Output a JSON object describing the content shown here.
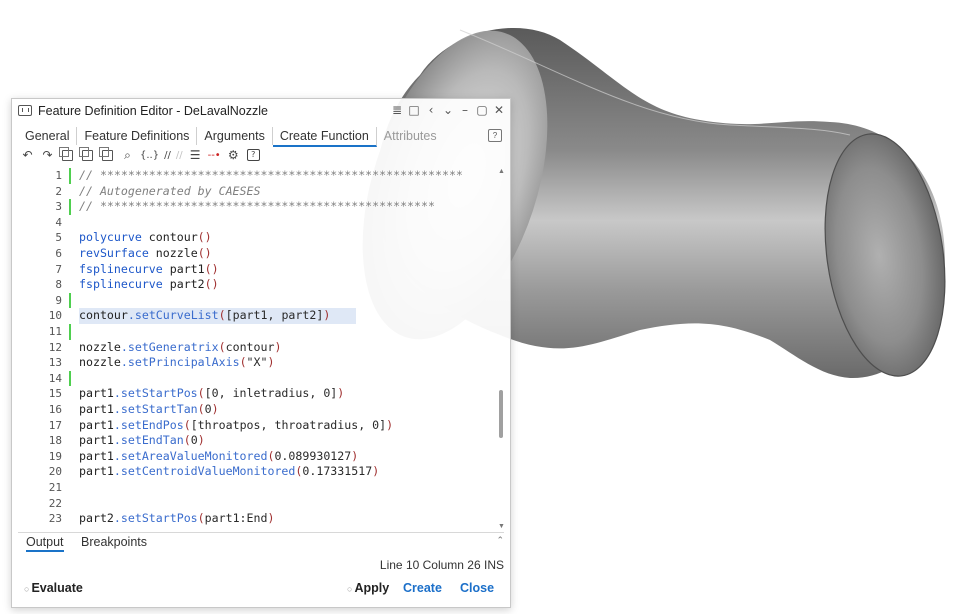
{
  "window": {
    "title": "Feature Definition Editor - DeLavalNozzle",
    "controls": [
      "≣",
      "□",
      "‹",
      "⌄",
      "–",
      "▢",
      "✕"
    ]
  },
  "tabs": [
    {
      "label": "General",
      "active": false,
      "enabled": true
    },
    {
      "label": "Feature Definitions",
      "active": false,
      "enabled": true
    },
    {
      "label": "Arguments",
      "active": false,
      "enabled": true
    },
    {
      "label": "Create Function",
      "active": true,
      "enabled": true
    },
    {
      "label": "Attributes",
      "active": false,
      "enabled": false
    }
  ],
  "toolbar": {
    "undo": "↶",
    "redo": "↷",
    "search": "⌕",
    "braces": "{..}",
    "comment": "//",
    "uncomment": "//",
    "indent": "☰",
    "breakpoint": "--•",
    "settings": "⚙",
    "help": "?"
  },
  "editor": {
    "lines": [
      {
        "n": "1",
        "kind": "comment",
        "text": "// ****************************************************",
        "changed": true
      },
      {
        "n": "2",
        "kind": "comment",
        "text": "// Autogenerated by CAESES",
        "changed": false
      },
      {
        "n": "3",
        "kind": "comment",
        "text": "// ************************************************",
        "changed": true
      },
      {
        "n": "4",
        "kind": "blank",
        "text": "",
        "changed": false
      },
      {
        "n": "5",
        "kind": "decl",
        "type": "polycurve",
        "name": "contour",
        "changed": false
      },
      {
        "n": "6",
        "kind": "decl",
        "type": "revSurface",
        "name": "nozzle",
        "changed": false
      },
      {
        "n": "7",
        "kind": "decl",
        "type": "fsplinecurve",
        "name": "part1",
        "changed": false
      },
      {
        "n": "8",
        "kind": "decl",
        "type": "fsplinecurve",
        "name": "part2",
        "changed": false
      },
      {
        "n": "9",
        "kind": "blank",
        "text": "",
        "changed": true
      },
      {
        "n": "10",
        "kind": "call",
        "obj": "contour",
        "method": "setCurveList",
        "args": "[part1, part2]",
        "changed": false,
        "current": true
      },
      {
        "n": "11",
        "kind": "blank",
        "text": "",
        "changed": true
      },
      {
        "n": "12",
        "kind": "call",
        "obj": "nozzle",
        "method": "setGeneratrix",
        "args": "contour",
        "changed": false
      },
      {
        "n": "13",
        "kind": "call",
        "obj": "nozzle",
        "method": "setPrincipalAxis",
        "args": "\"X\"",
        "changed": false
      },
      {
        "n": "14",
        "kind": "blank",
        "text": "",
        "changed": true
      },
      {
        "n": "15",
        "kind": "call",
        "obj": "part1",
        "method": "setStartPos",
        "args": "[0, inletradius, 0]",
        "changed": false
      },
      {
        "n": "16",
        "kind": "call",
        "obj": "part1",
        "method": "setStartTan",
        "args": "0",
        "changed": false
      },
      {
        "n": "17",
        "kind": "call",
        "obj": "part1",
        "method": "setEndPos",
        "args": "[throatpos, throatradius, 0]",
        "changed": false
      },
      {
        "n": "18",
        "kind": "call",
        "obj": "part1",
        "method": "setEndTan",
        "args": "0",
        "changed": false
      },
      {
        "n": "19",
        "kind": "call",
        "obj": "part1",
        "method": "setAreaValueMonitored",
        "args": "0.089930127",
        "changed": false
      },
      {
        "n": "20",
        "kind": "call",
        "obj": "part1",
        "method": "setCentroidValueMonitored",
        "args": "0.17331517",
        "changed": false
      },
      {
        "n": "21",
        "kind": "blank",
        "text": "",
        "changed": false
      },
      {
        "n": "22",
        "kind": "blank",
        "text": "",
        "changed": false
      },
      {
        "n": "23",
        "kind": "call",
        "obj": "part2",
        "method": "setStartPos",
        "args": "part1:End",
        "changed": false
      }
    ]
  },
  "bottom_tabs": [
    {
      "label": "Output",
      "active": true
    },
    {
      "label": "Breakpoints",
      "active": false
    }
  ],
  "status": {
    "text": "Line 10  Column 26 INS"
  },
  "footer": {
    "evaluate": "Evaluate",
    "apply": "Apply",
    "create": "Create",
    "close": "Close"
  },
  "colors": {
    "accent": "#1a73c8",
    "keyword": "#1d57c9",
    "paren": "#a03030",
    "comment": "#808080",
    "changed_marker": "#4fcf4f"
  },
  "nozzle": {
    "shape": "de-laval-nozzle",
    "material": "gray-metallic"
  }
}
